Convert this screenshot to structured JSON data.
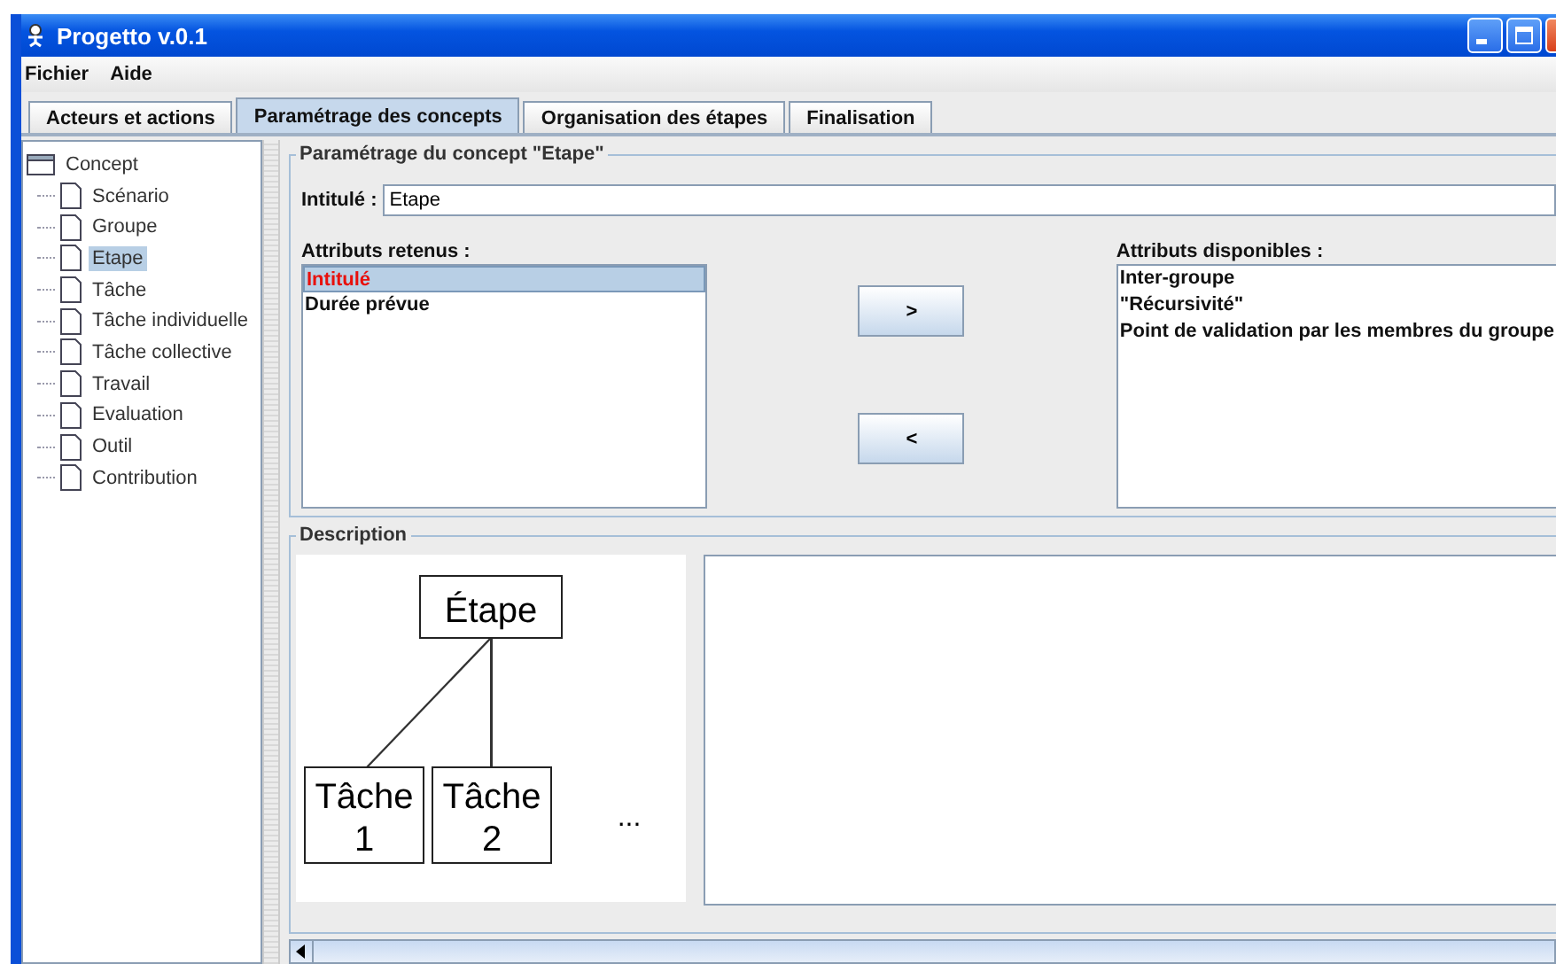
{
  "window": {
    "title": "Progetto v.0.1"
  },
  "menu": [
    "Fichier",
    "Aide"
  ],
  "tabs": [
    {
      "label": "Acteurs et actions",
      "selected": false
    },
    {
      "label": "Paramétrage des concepts",
      "selected": true
    },
    {
      "label": "Organisation des étapes",
      "selected": false
    },
    {
      "label": "Finalisation",
      "selected": false
    }
  ],
  "tree": {
    "label": "Concept",
    "children": [
      {
        "label": "Scénario",
        "selected": false
      },
      {
        "label": "Groupe",
        "selected": false
      },
      {
        "label": "Etape",
        "selected": true
      },
      {
        "label": "Tâche",
        "selected": false
      },
      {
        "label": "Tâche individuelle",
        "selected": false
      },
      {
        "label": "Tâche collective",
        "selected": false
      },
      {
        "label": "Travail",
        "selected": false
      },
      {
        "label": "Evaluation",
        "selected": false
      },
      {
        "label": "Outil",
        "selected": false
      },
      {
        "label": "Contribution",
        "selected": false
      }
    ]
  },
  "concept": {
    "title": "Paramétrage du concept \"Etape\"",
    "field_label": "Intitulé :",
    "field_value": "Etape",
    "retained": {
      "label": "Attributs retenus :",
      "items": [
        {
          "label": "Intitulé",
          "selected": true
        },
        {
          "label": "Durée prévue",
          "selected": false
        }
      ]
    },
    "buttons": [
      ">",
      "<"
    ],
    "available": {
      "label": "Attributs disponibles :",
      "items": [
        {
          "label": "Inter-groupe",
          "selected": false
        },
        {
          "label": "\"Récursivité\"",
          "selected": false
        },
        {
          "label": "Point de validation par les membres du groupe",
          "selected": false
        }
      ]
    }
  },
  "description": {
    "title": "Description",
    "diagram": {
      "root": "Étape",
      "children": [
        [
          "Tâche",
          "1"
        ],
        [
          "Tâche",
          "2"
        ]
      ],
      "more": "..."
    }
  }
}
